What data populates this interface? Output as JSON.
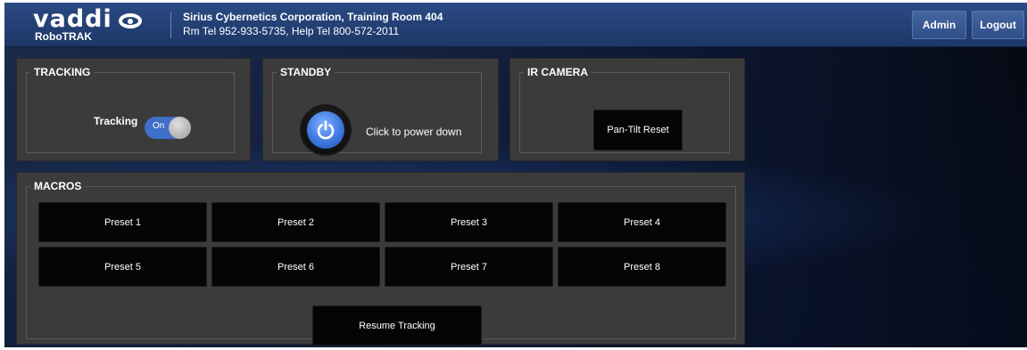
{
  "header": {
    "logo_word": "vaddi",
    "product": "RoboTRAK",
    "site_name": "Sirius Cybernetics Corporation, Training Room 404",
    "site_contacts": "Rm Tel 952-933-5735, Help Tel 800-572-2011",
    "admin_label": "Admin",
    "logout_label": "Logout"
  },
  "tracking": {
    "title": "TRACKING",
    "label": "Tracking",
    "toggle_state": "On"
  },
  "standby": {
    "title": "STANDBY",
    "text": "Click to power down",
    "icon": "power-icon"
  },
  "ir_camera": {
    "title": "IR CAMERA",
    "pan_tilt_reset_label": "Pan-Tilt Reset"
  },
  "macros": {
    "title": "MACROS",
    "presets": [
      {
        "label": "Preset 1"
      },
      {
        "label": "Preset 2"
      },
      {
        "label": "Preset 3"
      },
      {
        "label": "Preset 4"
      },
      {
        "label": "Preset 5"
      },
      {
        "label": "Preset 6"
      },
      {
        "label": "Preset 7"
      },
      {
        "label": "Preset 8"
      }
    ],
    "resume_label": "Resume Tracking"
  },
  "colors": {
    "header_bg": "#1d3767",
    "panel_bg": "#3b3b3b",
    "toggle_on": "#3f6fc7",
    "power_blue": "#3e78e0",
    "button_black": "#050505"
  }
}
